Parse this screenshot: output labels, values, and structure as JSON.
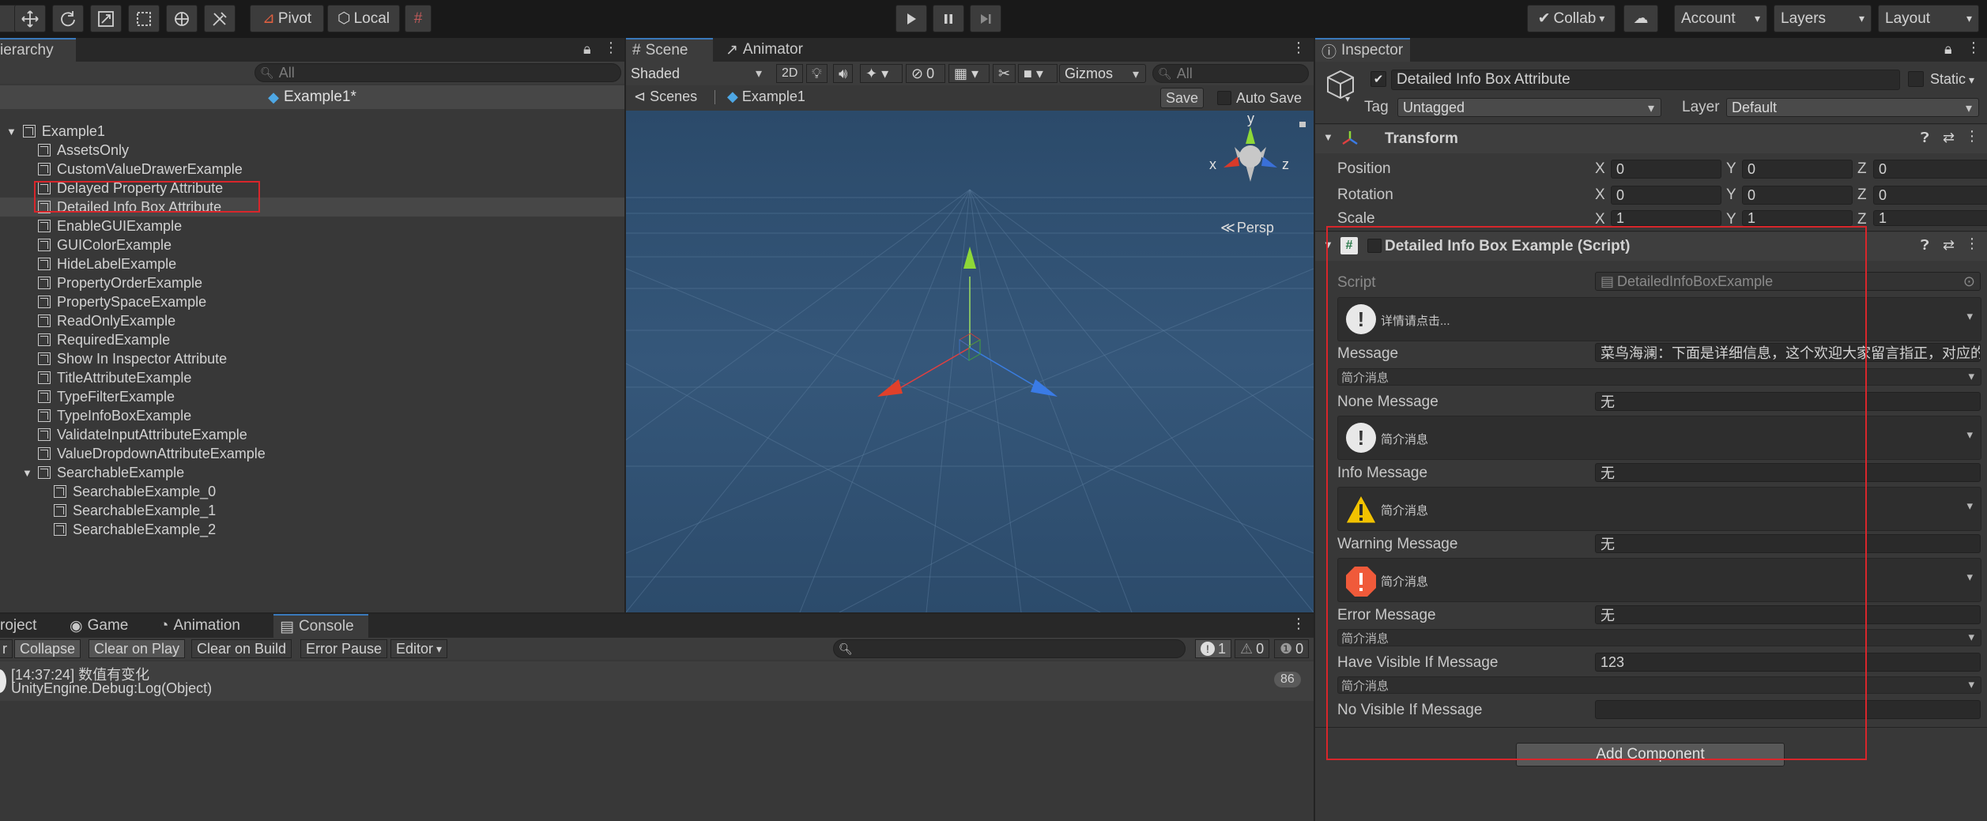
{
  "toolbar": {
    "pivot": "Pivot",
    "local": "Local",
    "collab": "Collab",
    "account": "Account",
    "layers": "Layers",
    "layout": "Layout"
  },
  "hierarchy": {
    "tab": "ierarchy",
    "search_placeholder": "All",
    "scene_title": "Example1*",
    "root": "Example1",
    "items": [
      "AssetsOnly",
      "CustomValueDrawerExample",
      "Delayed Property Attribute",
      "Detailed Info Box Attribute",
      "EnableGUIExample",
      "GUIColorExample",
      "HideLabelExample",
      "PropertyOrderExample",
      "PropertySpaceExample",
      "ReadOnlyExample",
      "RequiredExample",
      "Show In Inspector Attribute",
      "TitleAttributeExample",
      "TypeFilterExample",
      "TypeInfoBoxExample",
      "ValidateInputAttributeExample",
      "ValueDropdownAttributeExample",
      "SearchableExample"
    ],
    "children": [
      "SearchableExample_0",
      "SearchableExample_1",
      "SearchableExample_2"
    ]
  },
  "scene": {
    "tab_scene": "Scene",
    "tab_animator": "Animator",
    "shading": "Shaded",
    "mode_2d": "2D",
    "hidden_count": "0",
    "gizmos": "Gizmos",
    "search_placeholder": "All",
    "breadcrumb_scenes": "Scenes",
    "breadcrumb_scene": "Example1",
    "save": "Save",
    "autosave": "Auto Save",
    "axis_y": "y",
    "axis_x": "x",
    "axis_z": "z",
    "persp": "Persp"
  },
  "bottom": {
    "tab_project": "roject",
    "tab_game": "Game",
    "tab_animation": "Animation",
    "tab_console": "Console",
    "btn_clear_partial": "r",
    "btn_collapse": "Collapse",
    "btn_clear_on_play": "Clear on Play",
    "btn_clear_on_build": "Clear on Build",
    "btn_error_pause": "Error Pause",
    "btn_editor": "Editor",
    "count_log": "1",
    "count_warn": "0",
    "count_error": "0",
    "log_line1": "[14:37:24] 数值有变化",
    "log_line2": "UnityEngine.Debug:Log(Object)",
    "log_count": "86"
  },
  "inspector": {
    "tab": "Inspector",
    "object_name": "Detailed Info Box Attribute",
    "static": "Static",
    "tag_label": "Tag",
    "tag_value": "Untagged",
    "layer_label": "Layer",
    "layer_value": "Default",
    "transform_title": "Transform",
    "position": "Position",
    "rotation": "Rotation",
    "scale": "Scale",
    "x": "X",
    "y": "Y",
    "z": "Z",
    "pos": [
      "0",
      "0",
      "0"
    ],
    "rot": [
      "0",
      "0",
      "0"
    ],
    "scl": [
      "1",
      "1",
      "1"
    ],
    "component_title": "Detailed Info Box Example (Script)",
    "script_label": "Script",
    "script_value": "DetailedInfoBoxExample",
    "box1_text": "详情请点击...",
    "message_label": "Message",
    "message_value": "菜鸟海澜：下面是详细信息，这个欢迎大家留言指正，对应的",
    "brief": "简介消息",
    "none_label": "None Message",
    "none_value": "无",
    "info_label": "Info Message",
    "info_value": "无",
    "warning_label": "Warning Message",
    "warning_value": "无",
    "error_label": "Error Message",
    "error_value": "无",
    "have_visible_label": "Have Visible If Message",
    "have_visible_value": "123",
    "no_visible_label": "No Visible If Message",
    "add_component": "Add Component"
  },
  "colors": {
    "highlight_red": "#d8262b",
    "selection_blue": "#2c5d87",
    "warning_yellow": "#f2c200",
    "error_orange": "#f05a3a"
  }
}
